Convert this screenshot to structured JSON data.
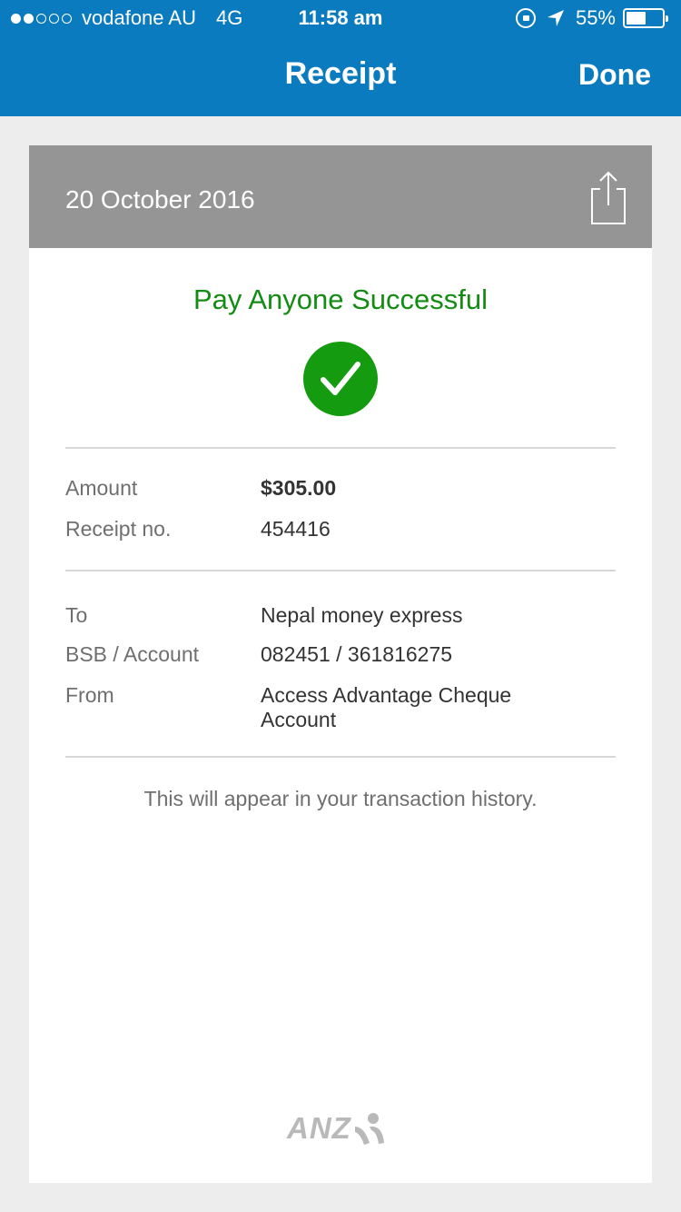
{
  "status_bar": {
    "carrier": "vodafone AU",
    "network": "4G",
    "time": "11:58 am",
    "battery": "55%",
    "battery_level": 0.55,
    "signal_bars_filled": 2,
    "signal_bars_total": 5
  },
  "nav": {
    "title": "Receipt",
    "done_label": "Done"
  },
  "receipt": {
    "date": "20 October 2016",
    "success_title": "Pay Anyone Successful",
    "amount_label": "Amount",
    "amount_value": "$305.00",
    "receipt_no_label": "Receipt no.",
    "receipt_no_value": "454416",
    "to_label": "To",
    "to_value": "Nepal money express",
    "bsb_label": "BSB / Account",
    "bsb_value": "082451 / 361816275",
    "from_label": "From",
    "from_value": "Access Advantage Cheque Account",
    "note": "This will appear in your transaction history."
  },
  "logo": {
    "text": "ANZ"
  },
  "colors": {
    "header_blue": "#0a7bbf",
    "success_green": "#148c14",
    "check_green": "#149b0f",
    "card_header_gray": "#959595",
    "background": "#ededed"
  },
  "icons": {
    "share": "share-icon",
    "check": "checkmark-icon",
    "location": "location-arrow-icon",
    "rotation_lock": "rotation-lock-icon",
    "battery": "battery-icon"
  }
}
